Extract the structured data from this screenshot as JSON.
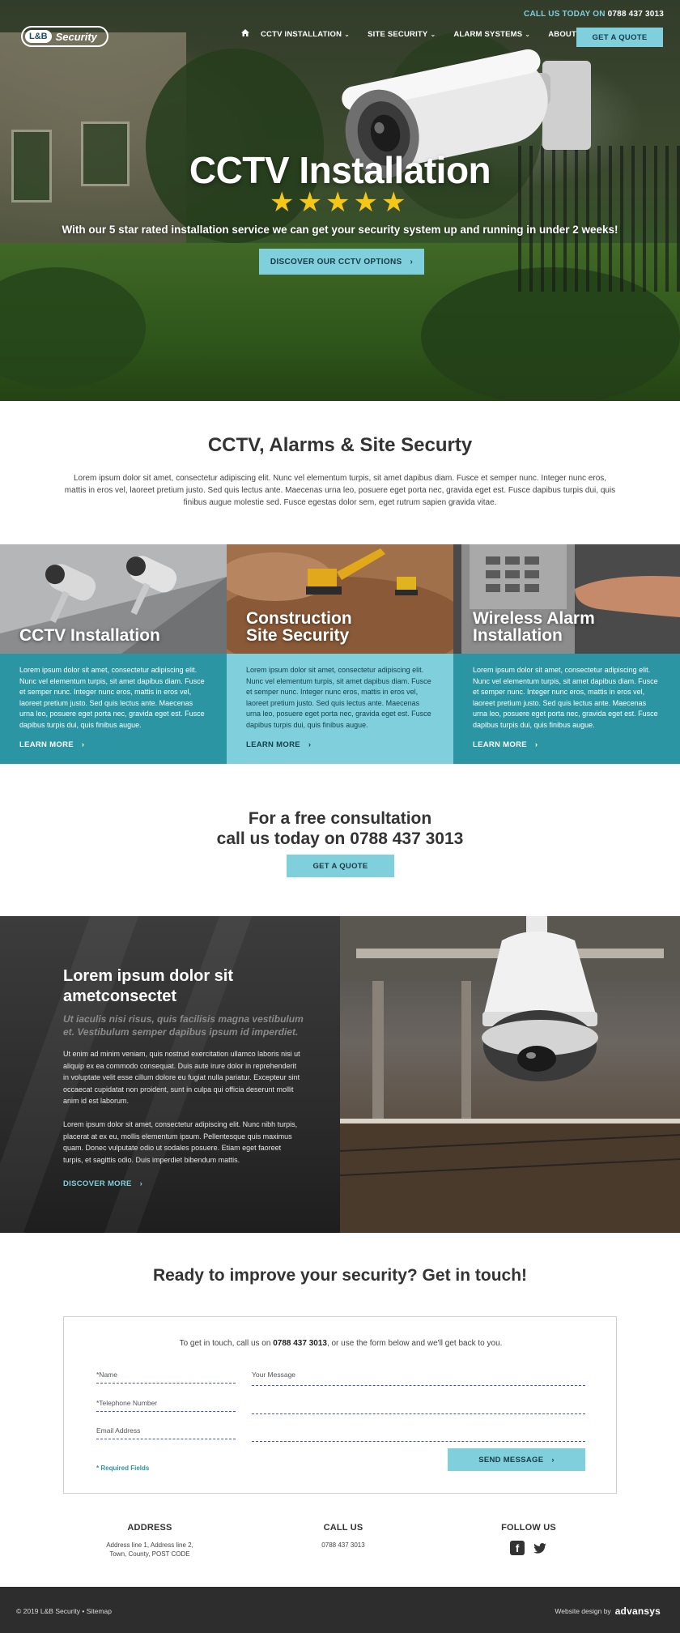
{
  "header": {
    "topline_label": "CALL US TODAY ON",
    "topline_phone": "0788 437 3013",
    "logo_left": "L&B",
    "logo_right": "Security",
    "nav": [
      {
        "label": "CCTV INSTALLATION"
      },
      {
        "label": "SITE SECURITY"
      },
      {
        "label": "ALARM SYSTEMS"
      },
      {
        "label": "ABOUT US"
      }
    ],
    "quote_button": "GET A QUOTE"
  },
  "hero": {
    "title": "CCTV Installation",
    "rating_stars": 5,
    "subtitle": "With our 5 star rated installation service we can get your security system up and running in under 2 weeks!",
    "cta": "DISCOVER OUR CCTV OPTIONS"
  },
  "intro": {
    "title": "CCTV, Alarms & Site Securty",
    "text": "Lorem ipsum dolor sit amet, consectetur adipiscing elit. Nunc vel elementum turpis, sit amet dapibus diam. Fusce et semper nunc. Integer nunc eros, mattis in eros vel, laoreet pretium justo. Sed quis lectus ante. Maecenas urna leo, posuere eget porta nec, gravida eget est. Fusce dapibus turpis dui, quis finibus augue molestie sed. Fusce egestas dolor sem, eget rutrum sapien gravida vitae."
  },
  "services": [
    {
      "title_1": "CCTV Installation",
      "title_2": "",
      "text": "Lorem ipsum dolor sit amet, consectetur adipiscing elit. Nunc vel elementum turpis, sit amet dapibus diam. Fusce et semper nunc. Integer nunc eros, mattis in eros vel, laoreet pretium justo. Sed quis lectus ante. Maecenas urna leo, posuere eget porta nec, gravida eget est. Fusce dapibus turpis dui, quis finibus augue.",
      "link": "LEARN MORE"
    },
    {
      "title_1": "Construction",
      "title_2": "Site Security",
      "text": "Lorem ipsum dolor sit amet, consectetur adipiscing elit. Nunc vel elementum turpis, sit amet dapibus diam. Fusce et semper nunc. Integer nunc eros, mattis in eros vel, laoreet pretium justo. Sed quis lectus ante. Maecenas urna leo, posuere eget porta nec, gravida eget est. Fusce dapibus turpis dui, quis finibus augue.",
      "link": "LEARN MORE"
    },
    {
      "title_1": "Wireless Alarm",
      "title_2": "Installation",
      "text": "Lorem ipsum dolor sit amet, consectetur adipiscing elit. Nunc vel elementum turpis, sit amet dapibus diam. Fusce et semper nunc. Integer nunc eros, mattis in eros vel, laoreet pretium justo. Sed quis lectus ante. Maecenas urna leo, posuere eget porta nec, gravida eget est. Fusce dapibus turpis dui, quis finibus augue.",
      "link": "LEARN MORE"
    }
  ],
  "consult": {
    "line1": "For a free consultation",
    "line2": "call us today on 0788 437 3013",
    "button": "GET A QUOTE"
  },
  "feature": {
    "title": "Lorem ipsum dolor sit ametconsectet",
    "subtitle": "Ut iaculis nisi risus, quis facilisis magna vestibulum et. Vestibulum semper dapibus ipsum id imperdiet.",
    "p1": "Ut enim ad minim veniam, quis nostrud exercitation ullamco laboris nisi ut aliquip ex ea commodo consequat. Duis aute irure dolor in reprehenderit in voluptate velit esse cillum dolore eu fugiat nulla pariatur. Excepteur sint occaecat cupidatat non proident, sunt in culpa qui officia deserunt mollit anim id est laborum.",
    "p2": "Lorem ipsum dolor sit amet, consectetur adipiscing elit. Nunc nibh turpis, placerat at ex eu, mollis elementum ipsum. Pellentesque quis maximus quam. Donec vulputate odio ut sodales posuere. Etiam eget faoreet turpis, et sagittis odio. Duis imperdiet bibendum mattis.",
    "link": "DISCOVER MORE"
  },
  "contact": {
    "title": "Ready to improve your security? Get in touch!",
    "intro_before": "To get in touch, call us on",
    "intro_phone": "0788 437 3013",
    "intro_after": ", or use the form below and we'll get back to you.",
    "fields": {
      "name": "*Name",
      "phone": "*Telephone Number",
      "email": "Email Address",
      "message": "Your Message"
    },
    "required_note": "* Required Fields",
    "send": "SEND MESSAGE"
  },
  "footer": {
    "address_heading": "ADDRESS",
    "address_line1": "Address line 1, Address line 2,",
    "address_line2": "Town, County, POST CODE",
    "call_heading": "CALL US",
    "call_number": "0788 437 3013",
    "follow_heading": "FOLLOW US",
    "social": [
      "facebook-icon",
      "twitter-icon"
    ],
    "copyright": "© 2019 L&B Security",
    "sitemap": "Sitemap",
    "credit_label": "Website design by",
    "credit_brand": "advansys"
  },
  "colors": {
    "accent": "#7fd0dc",
    "teal_dark": "#2b95a3",
    "star": "#f5c818",
    "footer_bar": "#2d2d2d"
  }
}
